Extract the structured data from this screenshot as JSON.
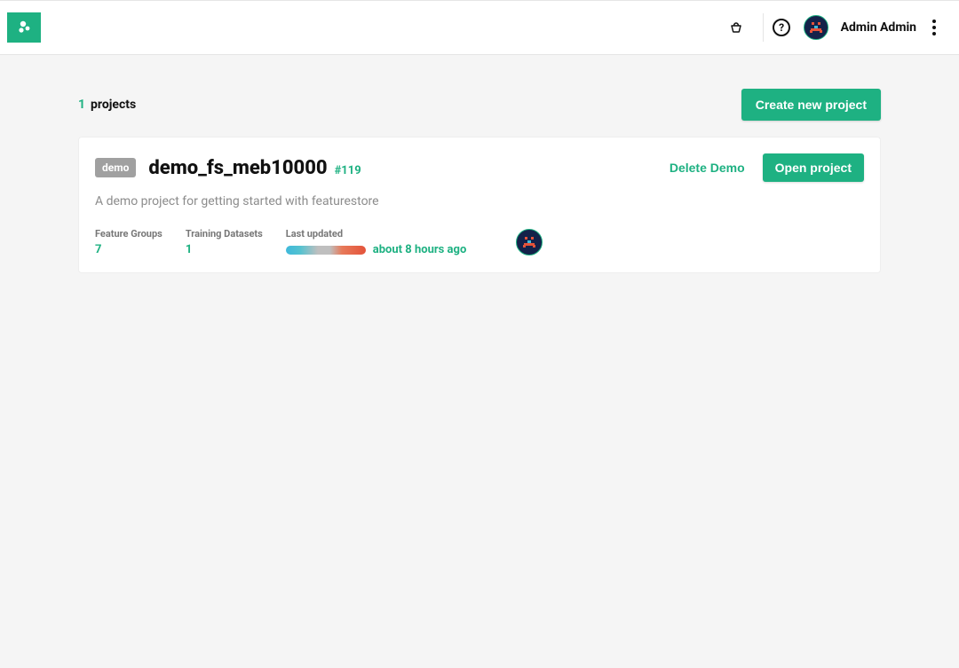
{
  "header": {
    "username": "Admin Admin"
  },
  "page": {
    "project_count": "1",
    "projects_label": "projects",
    "create_button": "Create new project"
  },
  "project": {
    "badge": "demo",
    "title": "demo_fs_meb10000",
    "id": "#119",
    "description": "A demo project for getting started with featurestore",
    "delete_label": "Delete Demo",
    "open_label": "Open project",
    "stats": {
      "feature_groups_label": "Feature Groups",
      "feature_groups_value": "7",
      "training_datasets_label": "Training Datasets",
      "training_datasets_value": "1",
      "last_updated_label": "Last updated",
      "last_updated_value": "about 8 hours ago"
    }
  },
  "colors": {
    "accent": "#1eb182"
  }
}
